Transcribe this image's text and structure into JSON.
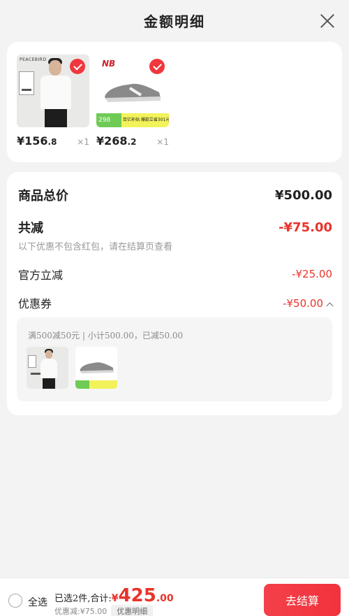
{
  "header": {
    "title": "金额明细"
  },
  "products": [
    {
      "brand": "PEACEBIRD",
      "price_main": "¥156",
      "price_decimal": ".8",
      "qty": "×1"
    },
    {
      "brand": "NB",
      "price_main": "¥268",
      "price_decimal": ".2",
      "qty": "×1",
      "promo_left": "298",
      "promo_right": "百亿补贴 爆款立省301元"
    }
  ],
  "summary": {
    "total_label": "商品总价",
    "total_value": "¥500.00",
    "discount_label": "共减",
    "discount_value": "-¥75.00",
    "discount_note": "以下优惠不包含红包，请在结算页查看",
    "official_label": "官方立减",
    "official_value": "-¥25.00",
    "coupon_label": "优惠券",
    "coupon_value": "-¥50.00",
    "coupon_desc": "满500减50元 | 小计500.00，已减50.00"
  },
  "footer": {
    "select_all": "全选",
    "sum_label": "已选2件,合计:",
    "sum_currency": "¥",
    "sum_main": "425",
    "sum_decimal": ".00",
    "discount_text": "优惠减:¥75.00",
    "detail_button": "优惠明细",
    "checkout_button": "去结算"
  },
  "colors": {
    "accent": "#e8342b",
    "checkout": "#f2323c"
  }
}
